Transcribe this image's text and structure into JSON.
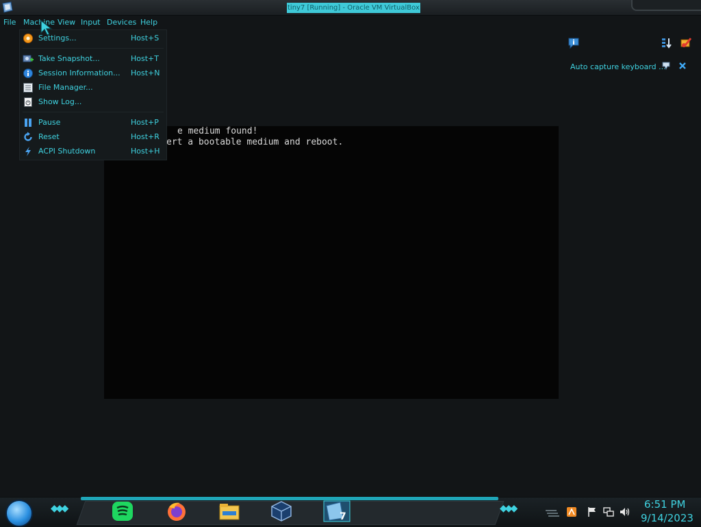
{
  "window": {
    "title": "tiny7 [Running] - Oracle VM VirtualBox",
    "app_icon": "virtualbox-icon"
  },
  "menubar": {
    "items": [
      "File",
      "Machine",
      "View",
      "Input",
      "Devices",
      "Help"
    ],
    "active": "Machine"
  },
  "machine_menu": {
    "items": [
      {
        "label": "Settings...",
        "shortcut": "Host+S",
        "icon": "settings-gear-icon"
      },
      {
        "label": "Take Snapshot...",
        "shortcut": "Host+T",
        "icon": "snapshot-icon"
      },
      {
        "label": "Session Information...",
        "shortcut": "Host+N",
        "icon": "info-icon"
      },
      {
        "label": "File Manager...",
        "shortcut": "",
        "icon": "file-manager-icon"
      },
      {
        "label": "Show Log...",
        "shortcut": "",
        "icon": "log-icon"
      },
      {
        "label": "Pause",
        "shortcut": "Host+P",
        "icon": "pause-icon"
      },
      {
        "label": "Reset",
        "shortcut": "Host+R",
        "icon": "reset-icon"
      },
      {
        "label": "ACPI Shutdown",
        "shortcut": "Host+H",
        "icon": "acpi-shutdown-icon"
      }
    ]
  },
  "vm_display": {
    "line1": "No bootable medium found!",
    "line2": "Please insert a bootable medium and reboot.",
    "line1_visible": "e medium found!",
    "line2_visible": "ert a bootable medium and reboot."
  },
  "notifications": {
    "auto_capture_text": "Auto capture keyboard ...",
    "icons": [
      "info-bubble-icon",
      "sort-icon",
      "paint-icon",
      "pin-icon",
      "close-icon"
    ]
  },
  "taskbar": {
    "pinned": [
      "spotify-icon",
      "firefox-icon",
      "file-explorer-icon",
      "virtualbox-icon",
      "windows7-vm-icon"
    ],
    "tray": [
      "orange-app-icon",
      "flag-icon",
      "network-icon",
      "volume-icon"
    ],
    "clock_time": "6:51 PM",
    "clock_date": "9/14/2023"
  },
  "colors": {
    "accent": "#3fd2e0",
    "background": "#121517",
    "vm_screen": "#050505",
    "title_highlight": "#3fc9d8"
  }
}
